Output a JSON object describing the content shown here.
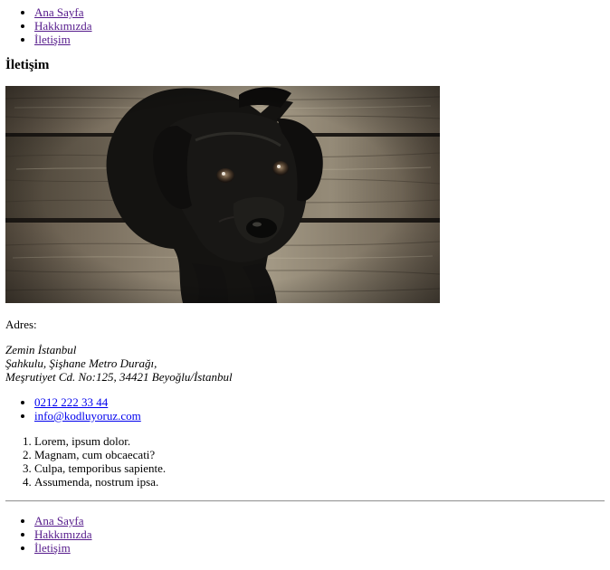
{
  "nav": {
    "items": [
      {
        "label": "Ana Sayfa"
      },
      {
        "label": "Hakkımızda"
      },
      {
        "label": "İletişim"
      }
    ]
  },
  "page": {
    "heading": "İletişim"
  },
  "address": {
    "label": "Adres:",
    "lines": [
      "Zemin İstanbul",
      "Şahkulu, Şişhane Metro Durağı,",
      "Meşrutiyet Cd. No:125, 34421 Beyoğlu/İstanbul"
    ]
  },
  "contact": {
    "phone": "0212 222 33 44",
    "email": "info@kodluyoruz.com"
  },
  "list": {
    "items": [
      "Lorem, ipsum dolor.",
      "Magnam, cum obcaecati?",
      "Culpa, temporibus sapiente.",
      "Assumenda, nostrum ipsa."
    ]
  },
  "footer_nav": {
    "items": [
      {
        "label": "Ana Sayfa"
      },
      {
        "label": "Hakkımızda"
      },
      {
        "label": "İletişim"
      }
    ]
  }
}
